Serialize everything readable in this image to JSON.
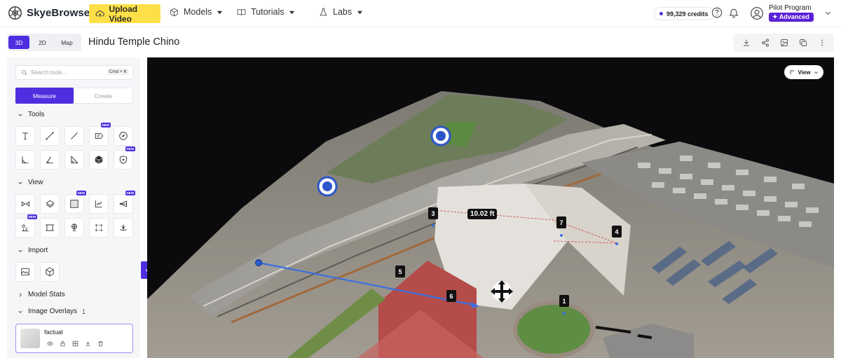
{
  "app": {
    "name": "SkyeBrowse"
  },
  "nav": {
    "upload_label": "Upload Video",
    "models_label": "Models",
    "tutorials_label": "Tutorials",
    "labs_label": "Labs"
  },
  "account": {
    "credits": "99,329 credits",
    "user_name": "Pilot Program",
    "plan": "Advanced"
  },
  "view_modes": [
    "3D",
    "2D",
    "Map"
  ],
  "active_view_mode": "3D",
  "model": {
    "title": "Hindu Temple Chino"
  },
  "sidebar": {
    "search_placeholder": "Search tools...",
    "search_shortcut": "Cmd + K",
    "tabs": [
      "Measure",
      "Create"
    ],
    "active_tab": "Measure",
    "sections": {
      "tools": "Tools",
      "view": "View",
      "import": "Import",
      "model_stats": "Model Stats",
      "image_overlays": "Image Overlays",
      "image_overlays_count": "1"
    },
    "new_badge": "NEW",
    "overlay_item": {
      "name": "factual"
    }
  },
  "viewport": {
    "view_button": "View",
    "distance_label": "10.02 ft",
    "markers": [
      "1",
      "3",
      "4",
      "5",
      "6",
      "7"
    ]
  },
  "colors": {
    "accent": "#4f2ee0",
    "upload": "#fde047",
    "measure_line": "#3b6fe0"
  }
}
